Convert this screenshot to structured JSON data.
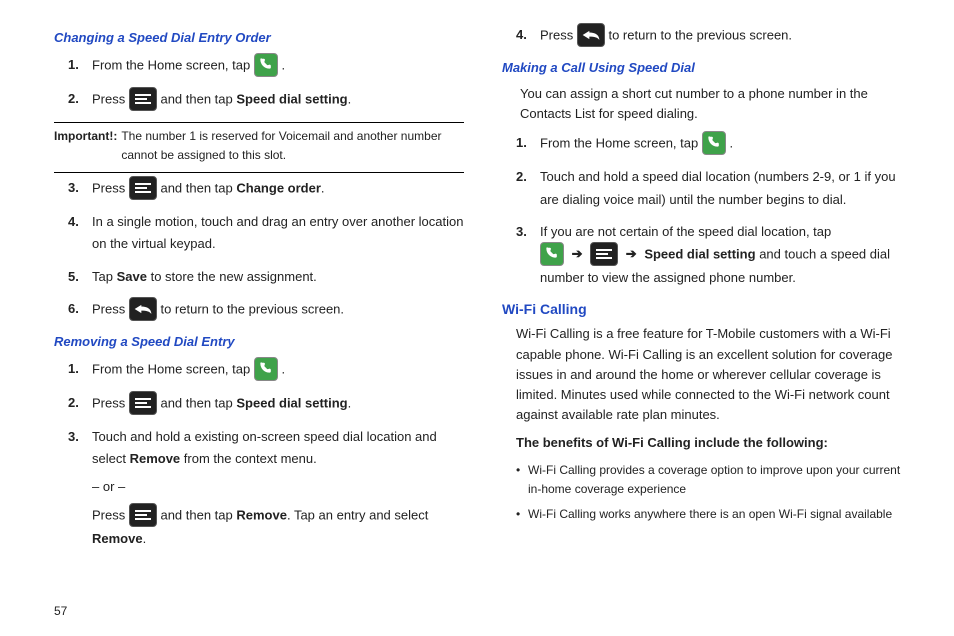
{
  "page_number": "57",
  "left": {
    "h1": "Changing a Speed Dial Entry Order",
    "s1": {
      "n": "1.",
      "a": "From the Home screen, tap ",
      "c": "."
    },
    "s2": {
      "n": "2.",
      "a": "Press ",
      "b": " and then tap ",
      "bold": "Speed dial setting",
      "c": "."
    },
    "note_label": "Important!:",
    "note_text": "The number 1 is reserved for Voicemail and another number cannot be assigned to this slot.",
    "s3": {
      "n": "3.",
      "a": "Press ",
      "b": " and then tap ",
      "bold": "Change order",
      "c": "."
    },
    "s4": {
      "n": "4.",
      "t": "In a single motion, touch and drag an entry over another location on the virtual keypad."
    },
    "s5": {
      "n": "5.",
      "a": "Tap ",
      "bold": "Save",
      "c": " to store the new assignment."
    },
    "s6": {
      "n": "6.",
      "a": "Press ",
      "c": " to return to the previous screen."
    },
    "h2": "Removing a Speed Dial Entry",
    "r1": {
      "n": "1.",
      "a": "From the Home screen, tap ",
      "c": "."
    },
    "r2": {
      "n": "2.",
      "a": "Press ",
      "b": " and then tap ",
      "bold": "Speed dial setting",
      "c": "."
    },
    "r3": {
      "n": "3.",
      "a": "Touch and hold a existing on-screen speed dial location and select ",
      "bold": "Remove",
      "c": " from the context menu.",
      "or": "– or –",
      "d": "Press ",
      "e": " and then tap ",
      "bold2": "Remove",
      "f": ". Tap an entry and select ",
      "bold3": "Remove",
      "g": "."
    }
  },
  "right": {
    "s4": {
      "n": "4.",
      "a": "Press ",
      "c": " to return to the previous screen."
    },
    "h1": "Making a Call Using Speed Dial",
    "intro": "You can assign a short cut number to a phone number in the Contacts List for speed dialing.",
    "m1": {
      "n": "1.",
      "a": "From the Home screen, tap ",
      "c": "."
    },
    "m2": {
      "n": "2.",
      "t": "Touch and hold a speed dial location (numbers 2-9, or 1 if you are dialing voice mail) until the number begins to dial."
    },
    "m3": {
      "n": "3.",
      "a": "If you are not certain of the speed dial location, tap ",
      "arrow": "➔",
      "bold": "Speed dial setting",
      "c": " and touch a speed dial number to view the assigned phone number."
    },
    "h2": "Wi-Fi Calling",
    "wifi_p": "Wi-Fi Calling is a free feature for T-Mobile customers with a Wi-Fi capable phone. Wi-Fi Calling is an excellent solution for coverage issues in and around the home or wherever cellular coverage is limited. Minutes used while connected to the Wi-Fi network count against available rate plan minutes.",
    "wifi_b": "The benefits of Wi-Fi Calling include the following:",
    "bul1": "Wi-Fi Calling provides a coverage option to improve upon your current in-home coverage experience",
    "bul2": "Wi-Fi Calling works anywhere there is an open Wi-Fi signal available"
  }
}
